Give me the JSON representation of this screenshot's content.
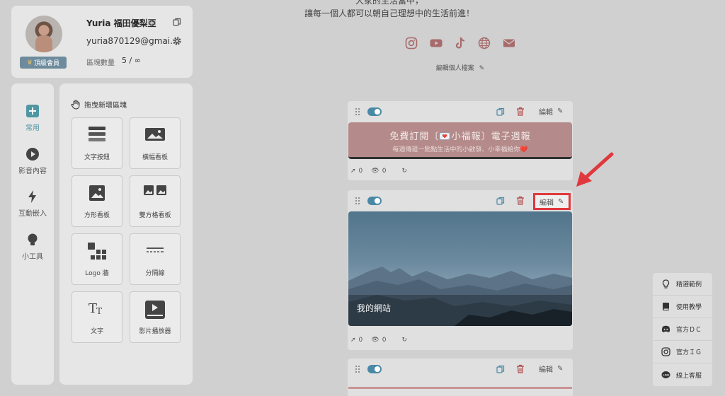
{
  "profile": {
    "name": "Yuria 福田優梨亞",
    "email": "yuria870129@gmai...",
    "badge": "頂級會員",
    "block_count_label": "區塊數量",
    "block_count_value": "5 / ∞"
  },
  "categories": [
    {
      "label": "常用",
      "icon": "plus-icon",
      "active": true
    },
    {
      "label": "影音內容",
      "icon": "play-icon"
    },
    {
      "label": "互動嵌入",
      "icon": "bolt-icon"
    },
    {
      "label": "小工具",
      "icon": "bulb-icon"
    }
  ],
  "palette": {
    "title": "拖曳新增區塊",
    "tiles": [
      {
        "label": "文字按鈕",
        "icon": "text-button-icon"
      },
      {
        "label": "橫幅看板",
        "icon": "banner-image-icon"
      },
      {
        "label": "方形看板",
        "icon": "square-image-icon"
      },
      {
        "label": "雙方格看板",
        "icon": "double-image-icon"
      },
      {
        "label": "Logo 牆",
        "icon": "logo-wall-icon"
      },
      {
        "label": "分隔線",
        "icon": "divider-icon"
      },
      {
        "label": "文字",
        "icon": "text-icon"
      },
      {
        "label": "影片播放器",
        "icon": "video-player-icon"
      }
    ]
  },
  "page": {
    "line1": "大家的生活當中，",
    "line2": "讓每一個人都可以朝自己理想中的生活前進！",
    "social_icons": [
      "instagram-icon",
      "youtube-icon",
      "tiktok-icon",
      "globe-icon",
      "mail-icon"
    ],
    "edit_profile": "編輯個人檔案"
  },
  "blocks": [
    {
      "edit_label": "編輯",
      "newsletter_title": "免費訂閱〔💌小福報〕電子週報",
      "newsletter_sub": "每週傳遞一點點生活中的小啟發、小幸福給你❤️",
      "clicks": "0",
      "views": "0"
    },
    {
      "edit_label": "編輯",
      "banner_label": "我的網站",
      "clicks": "0",
      "views": "0"
    },
    {
      "edit_label": "編輯"
    }
  ],
  "help_menu": [
    {
      "label": "精選範例",
      "icon": "bulb-outline-icon"
    },
    {
      "label": "使用教學",
      "icon": "book-icon"
    },
    {
      "label": "官方ＤＣ",
      "icon": "discord-icon"
    },
    {
      "label": "官方ＩＧ",
      "icon": "instagram-icon"
    },
    {
      "label": "線上客服",
      "icon": "line-icon"
    }
  ],
  "colors": {
    "accent": "#5096a3",
    "highlight": "#e0383d",
    "trash": "#b04545"
  }
}
